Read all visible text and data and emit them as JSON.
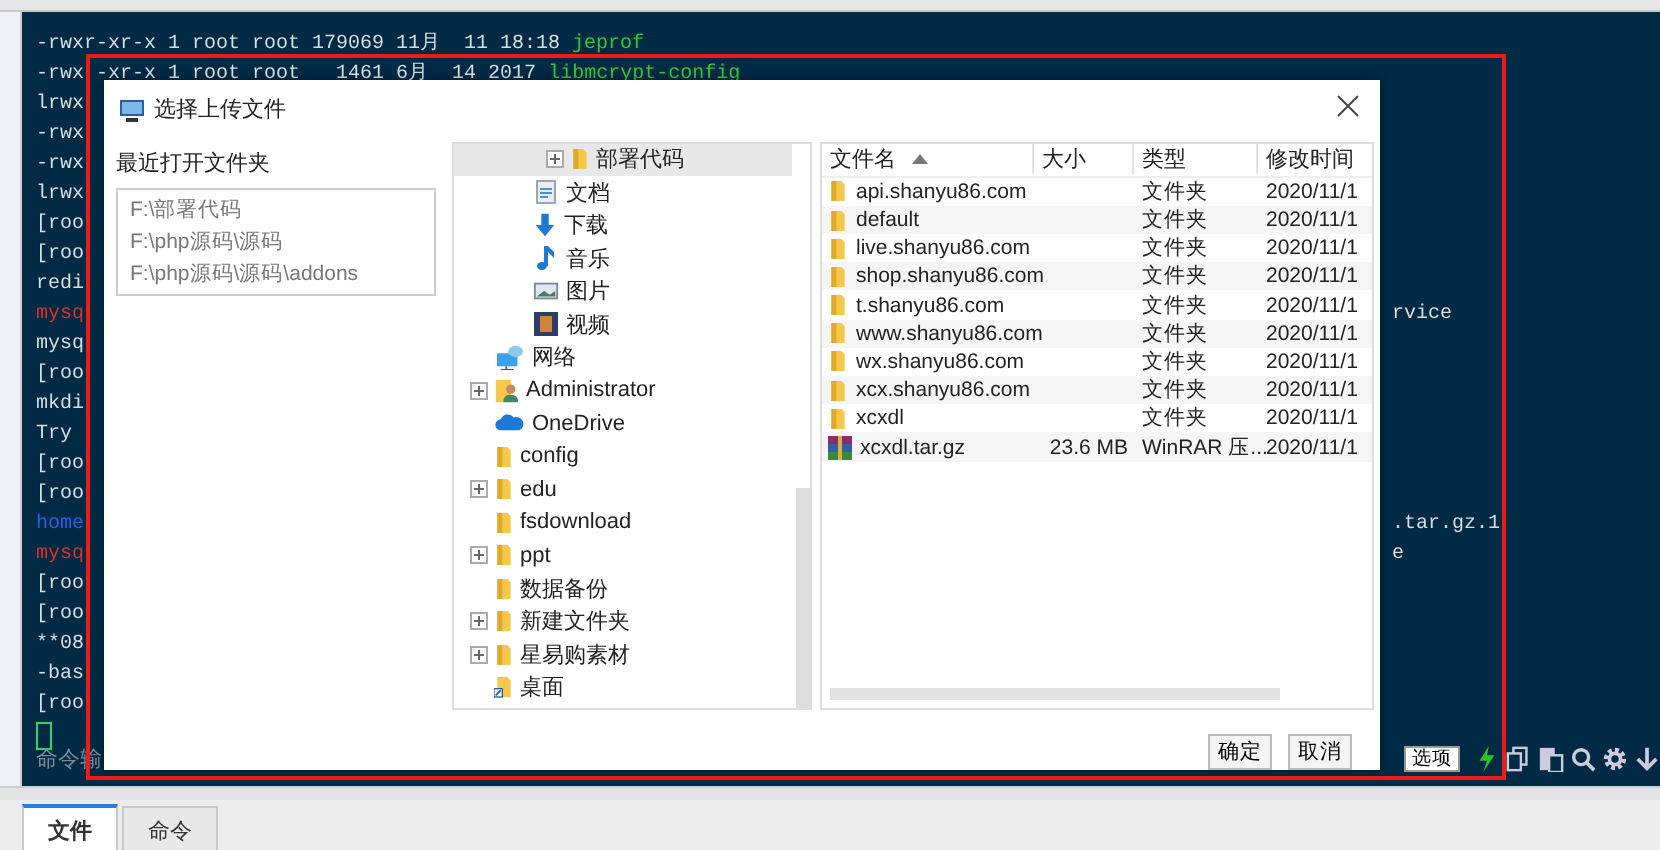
{
  "terminal": {
    "lines": [
      {
        "segments": [
          {
            "text": "-rwxr-xr-x 1 root root 179069 11月  11 18:18 ",
            "color": "#d8dde2"
          },
          {
            "text": "jeprof",
            "color": "#34c934"
          }
        ]
      },
      {
        "segments": [
          {
            "text": "-rwx",
            "color": "#d8dde2"
          },
          {
            "text": "-xr-x 1 root root   1461 6月  14 2017 ",
            "color": "#d8dde2"
          },
          {
            "text": "libmcrypt-config",
            "color": "#34c934"
          }
        ]
      },
      {
        "segments": [
          {
            "text": "lrwx",
            "color": "#d8dde2"
          }
        ]
      },
      {
        "segments": [
          {
            "text": "-rwx",
            "color": "#d8dde2"
          }
        ]
      },
      {
        "segments": [
          {
            "text": "-rwx",
            "color": "#d8dde2"
          }
        ]
      },
      {
        "segments": [
          {
            "text": "lrwx",
            "color": "#d8dde2"
          }
        ]
      },
      {
        "segments": [
          {
            "text": "[roo",
            "color": "#d8dde2"
          }
        ]
      },
      {
        "segments": [
          {
            "text": "[roo",
            "color": "#d8dde2"
          }
        ]
      },
      {
        "segments": [
          {
            "text": "redi",
            "color": "#d8dde2"
          }
        ]
      },
      {
        "segments": [
          {
            "text": "mysq",
            "color": "#e0302c"
          }
        ],
        "right": "rvice"
      },
      {
        "segments": [
          {
            "text": "mysq",
            "color": "#d8dde2"
          }
        ]
      },
      {
        "segments": [
          {
            "text": "[roo",
            "color": "#d8dde2"
          }
        ]
      },
      {
        "segments": [
          {
            "text": "mkdi",
            "color": "#d8dde2"
          }
        ]
      },
      {
        "segments": [
          {
            "text": "Try",
            "color": "#d8dde2"
          }
        ]
      },
      {
        "segments": [
          {
            "text": "[roo",
            "color": "#d8dde2"
          }
        ]
      },
      {
        "segments": [
          {
            "text": "[roo",
            "color": "#d8dde2"
          }
        ]
      },
      {
        "segments": [
          {
            "text": "home",
            "color": "#2a62e6"
          }
        ],
        "right": ".tar.gz.1"
      },
      {
        "segments": [
          {
            "text": "mysq",
            "color": "#e0302c"
          }
        ],
        "right": "e"
      },
      {
        "segments": [
          {
            "text": "[roo",
            "color": "#d8dde2"
          }
        ]
      },
      {
        "segments": [
          {
            "text": "[roo",
            "color": "#d8dde2"
          }
        ]
      },
      {
        "segments": [
          {
            "text": "**08",
            "color": "#d8dde2"
          }
        ]
      },
      {
        "segments": [
          {
            "text": "-bas",
            "color": "#d8dde2"
          }
        ]
      },
      {
        "segments": [
          {
            "text": "[roo",
            "color": "#d8dde2"
          }
        ]
      }
    ],
    "command_bar": {
      "label": "命令输",
      "options_button": "选项"
    }
  },
  "dialog": {
    "title": "选择上传文件",
    "recent": {
      "heading": "最近打开文件夹",
      "items": [
        "F:\\部署代码",
        "F:\\php源码\\源码",
        "F:\\php源码\\源码\\addons"
      ]
    },
    "tree": {
      "items": [
        {
          "children": [
            {
              "children": [
                {
                  "label": "部署代码",
                  "kind": "folder",
                  "expandable": true,
                  "selected": true
                }
              ]
            },
            {
              "label": "文档",
              "kind": "documents",
              "expandable": false,
              "selected": false
            },
            {
              "label": "下载",
              "kind": "download",
              "expandable": false,
              "selected": false
            },
            {
              "label": "音乐",
              "kind": "music",
              "expandable": false,
              "selected": false
            },
            {
              "label": "图片",
              "kind": "pictures",
              "expandable": false,
              "selected": false
            },
            {
              "label": "视频",
              "kind": "video",
              "expandable": false,
              "selected": false
            }
          ]
        },
        {
          "label": "网络",
          "kind": "network",
          "expandable": false,
          "selected": false
        },
        {
          "label": "Administrator",
          "kind": "user",
          "expandable": true,
          "selected": false
        },
        {
          "label": "OneDrive",
          "kind": "cloud",
          "expandable": false,
          "selected": false
        },
        {
          "label": "config",
          "kind": "folder",
          "expandable": false,
          "selected": false
        },
        {
          "label": "edu",
          "kind": "folder",
          "expandable": true,
          "selected": false
        },
        {
          "label": "fsdownload",
          "kind": "folder",
          "expandable": false,
          "selected": false
        },
        {
          "label": "ppt",
          "kind": "folder",
          "expandable": true,
          "selected": false
        },
        {
          "label": "数据备份",
          "kind": "folder",
          "expandable": false,
          "selected": false
        },
        {
          "label": "新建文件夹",
          "kind": "folder",
          "expandable": true,
          "selected": false
        },
        {
          "label": "星易购素材",
          "kind": "folder",
          "expandable": true,
          "selected": false
        },
        {
          "label": "桌面",
          "kind": "shortcut",
          "expandable": false,
          "selected": false
        }
      ]
    },
    "files": {
      "columns": [
        "文件名",
        "大小",
        "类型",
        "修改时间"
      ],
      "rows": [
        {
          "name": "api.shanyu86.com",
          "type": "文件夹",
          "date": "2020/11/1",
          "kind": "folder"
        },
        {
          "name": "default",
          "type": "文件夹",
          "date": "2020/11/1",
          "kind": "folder"
        },
        {
          "name": "live.shanyu86.com",
          "type": "文件夹",
          "date": "2020/11/1",
          "kind": "folder"
        },
        {
          "name": "shop.shanyu86.com",
          "type": "文件夹",
          "date": "2020/11/1",
          "kind": "folder"
        },
        {
          "name": "t.shanyu86.com",
          "type": "文件夹",
          "date": "2020/11/1",
          "kind": "folder"
        },
        {
          "name": "www.shanyu86.com",
          "type": "文件夹",
          "date": "2020/11/1",
          "kind": "folder"
        },
        {
          "name": "wx.shanyu86.com",
          "type": "文件夹",
          "date": "2020/11/1",
          "kind": "folder"
        },
        {
          "name": "xcx.shanyu86.com",
          "type": "文件夹",
          "date": "2020/11/1",
          "kind": "folder"
        },
        {
          "name": "xcxdl",
          "type": "文件夹",
          "date": "2020/11/1",
          "kind": "folder"
        },
        {
          "name": "xcxdl.tar.gz",
          "size": "23.6 MB",
          "type": "WinRAR 压...",
          "date": "2020/11/1",
          "kind": "archive"
        }
      ]
    },
    "buttons": [
      "确定",
      "取消"
    ]
  },
  "bottom_tabs": [
    {
      "label": "文件",
      "selected": true
    },
    {
      "label": "命令",
      "selected": false
    }
  ]
}
